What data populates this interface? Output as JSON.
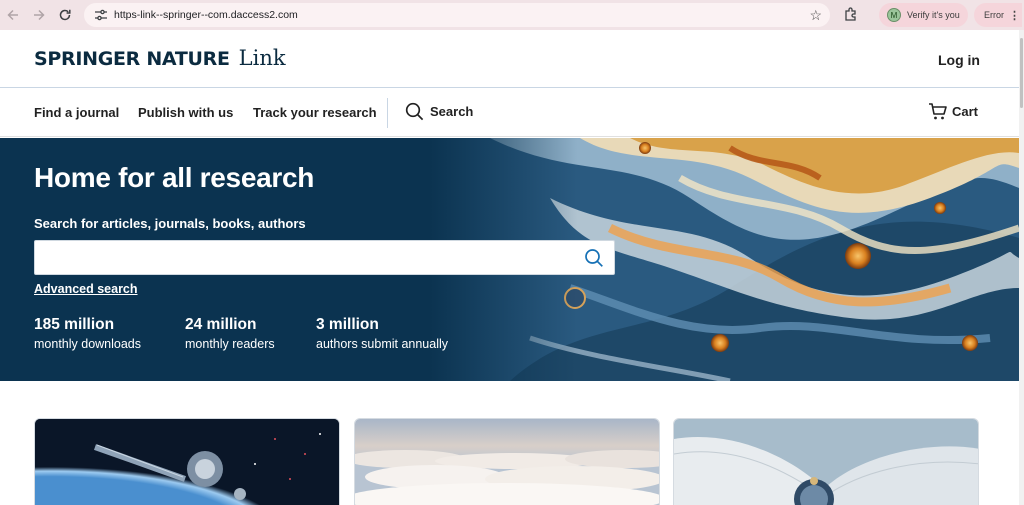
{
  "browser": {
    "url": "https-link--springer--com.daccess2.com",
    "verify_label": "Verify it's you",
    "verify_avatar": "M",
    "error_label": "Error"
  },
  "header": {
    "brand": "SPRINGER NATURE",
    "link_word": "Link",
    "login": "Log in"
  },
  "nav": {
    "items": [
      {
        "label": "Find a journal"
      },
      {
        "label": "Publish with us"
      },
      {
        "label": "Track your research"
      }
    ],
    "search_label": "Search",
    "cart_label": "Cart"
  },
  "hero": {
    "title": "Home for all research",
    "search_prompt": "Search for articles, journals, books, authors",
    "search_value": "",
    "advanced_search": "Advanced search",
    "stats": [
      {
        "value": "185 million",
        "label": "monthly downloads"
      },
      {
        "value": "24 million",
        "label": "monthly readers"
      },
      {
        "value": "3 million",
        "label": "authors submit annually"
      }
    ]
  },
  "icons": {
    "back": "back-arrow-icon",
    "forward": "forward-arrow-icon",
    "reload": "reload-icon",
    "site_info": "tune-icon",
    "bookmark": "star-icon",
    "extensions": "puzzle-icon",
    "search": "search-icon",
    "cart": "cart-icon",
    "menu": "kebab-menu-icon"
  },
  "colors": {
    "hero_bg": "#0b3350",
    "brand_text": "#0b2b40",
    "chrome_bg": "#f1e3e6"
  }
}
